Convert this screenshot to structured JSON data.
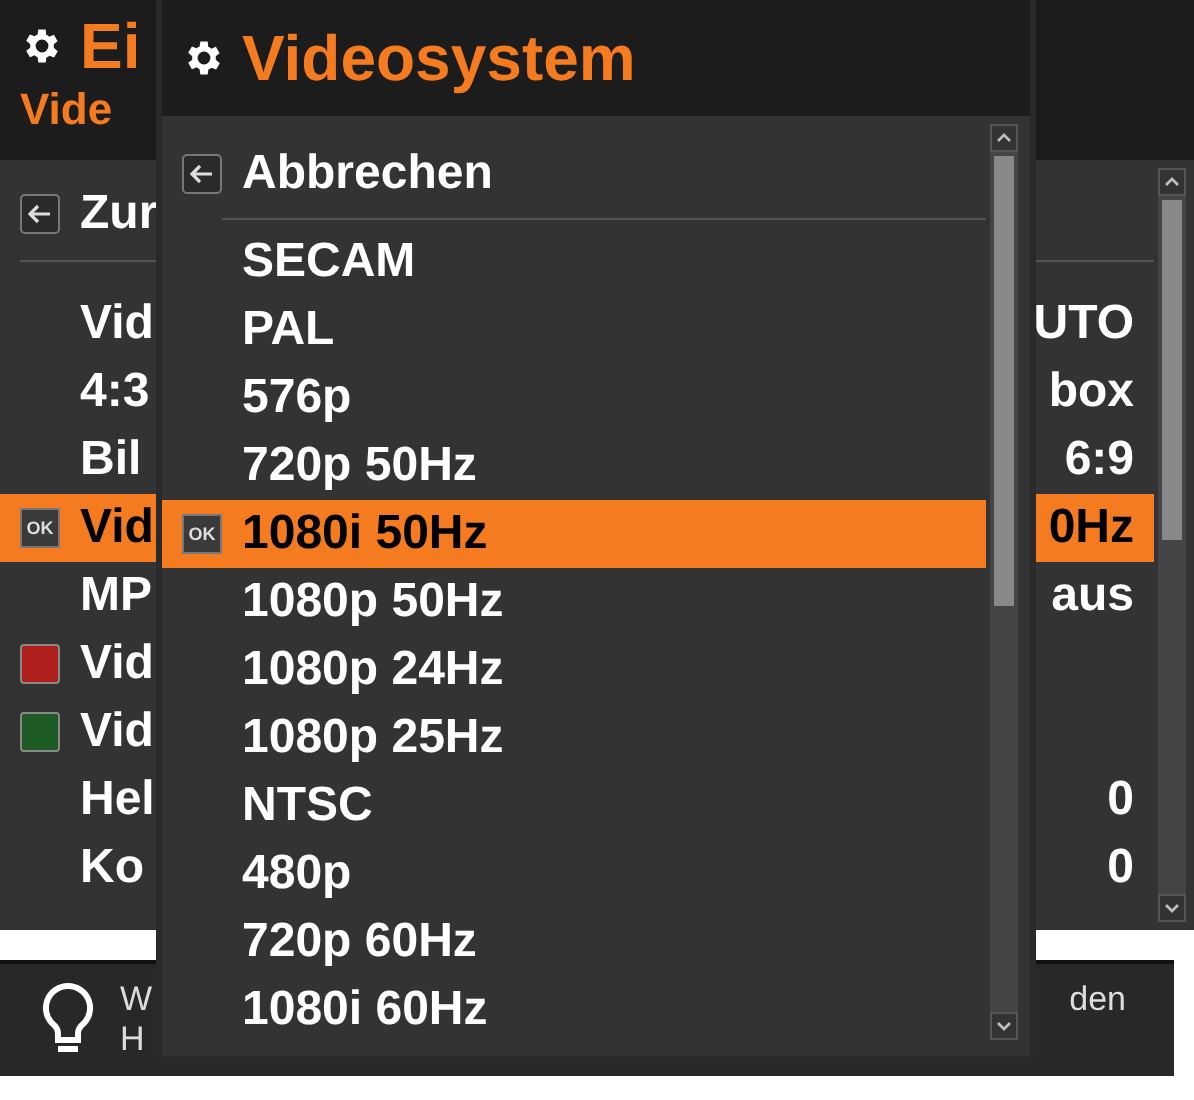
{
  "settings_window": {
    "title": "Ei",
    "subtitle": "Vide",
    "back_label": "Zur",
    "selected_badge": "OK",
    "items": [
      {
        "label": "Vid",
        "value": "UTO",
        "selected": false
      },
      {
        "label": "4:3",
        "value": "box",
        "selected": false
      },
      {
        "label": "Bil",
        "value": "6:9",
        "selected": false
      },
      {
        "label": "Vid",
        "value": "0Hz",
        "selected": true
      },
      {
        "label": "MP",
        "value": "aus",
        "selected": false
      },
      {
        "label": "Vid",
        "selected": false,
        "color": "#b01e1e"
      },
      {
        "label": "Vid",
        "selected": false,
        "color": "#1e5a23"
      },
      {
        "label": "Hel",
        "value": "0",
        "selected": false
      },
      {
        "label": "Ko",
        "value": "0",
        "selected": false
      }
    ]
  },
  "hint_bar": {
    "line_1_start": "W",
    "line_1_end": "den",
    "line_2_start": "H"
  },
  "popup": {
    "title": "Videosystem",
    "cancel_label": "Abbrechen",
    "selected_badge": "OK",
    "options": [
      {
        "label": "SECAM",
        "selected": false
      },
      {
        "label": "PAL",
        "selected": false
      },
      {
        "label": "576p",
        "selected": false
      },
      {
        "label": "720p 50Hz",
        "selected": false
      },
      {
        "label": "1080i 50Hz",
        "selected": true
      },
      {
        "label": "1080p 50Hz",
        "selected": false
      },
      {
        "label": "1080p 24Hz",
        "selected": false
      },
      {
        "label": "1080p 25Hz",
        "selected": false
      },
      {
        "label": "NTSC",
        "selected": false
      },
      {
        "label": "480p",
        "selected": false
      },
      {
        "label": "720p 60Hz",
        "selected": false
      },
      {
        "label": "1080i 60Hz",
        "selected": false
      }
    ]
  }
}
